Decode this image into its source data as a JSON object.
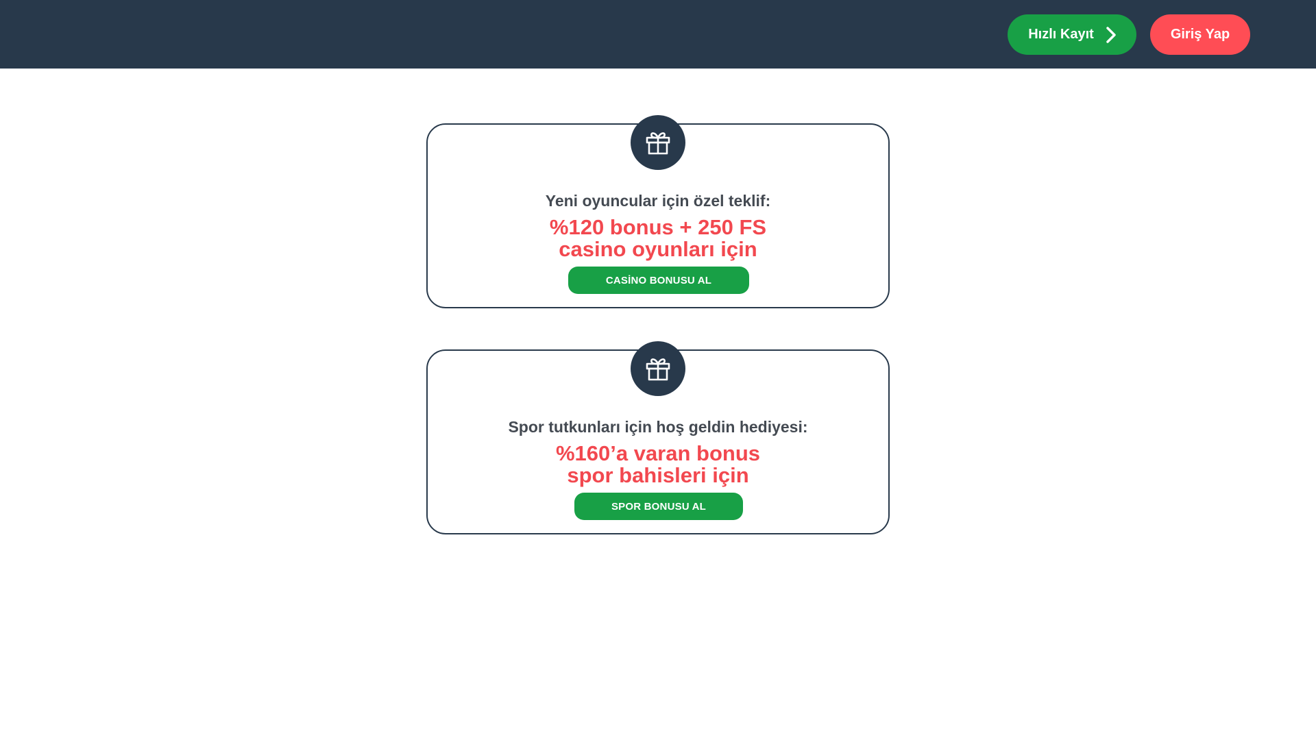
{
  "header": {
    "register_label": "Hızlı Kayıt",
    "login_label": "Giriş Yap",
    "colors": {
      "background": "#28394b",
      "register": "#18a046",
      "login": "#ff4d55"
    }
  },
  "cards": [
    {
      "icon": "gift-icon",
      "subtitle": "Yeni oyuncular için özel teklif:",
      "offer_line1": "%120 bonus + 250 FS",
      "offer_line2": "casino oyunları için",
      "cta_label": "CASİNO BONUSU AL"
    },
    {
      "icon": "gift-icon",
      "subtitle": "Spor tutkunları için hoş geldin hediyesi:",
      "offer_line1": "%160’a varan bonus",
      "offer_line2": "spor bahisleri için",
      "cta_label": "SPOR BONUSU AL"
    }
  ],
  "colors": {
    "accent": "#f2484f",
    "cta": "#18a046",
    "border": "#28394b"
  }
}
